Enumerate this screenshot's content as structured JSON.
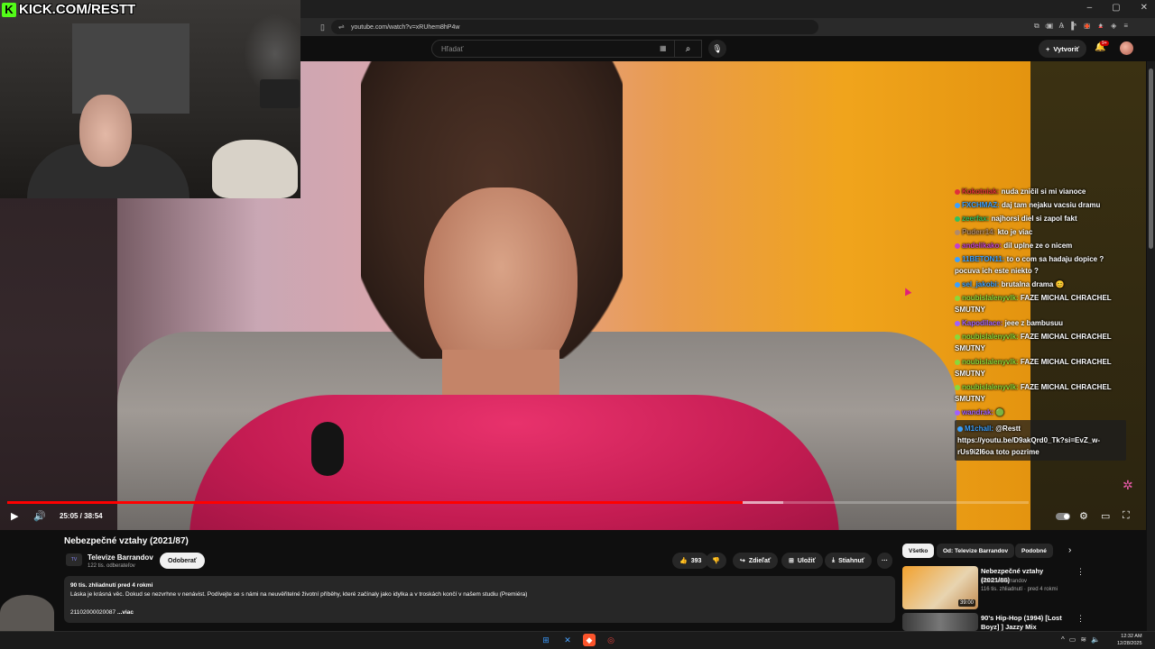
{
  "stream": {
    "kick_url": "KICK.COM/RESTT"
  },
  "browser": {
    "url": "youtube.com/watch?v=xRUhem8hP4w",
    "window_controls": [
      "–",
      "▢",
      "✕"
    ]
  },
  "yt_header": {
    "search_placeholder": "Hľadať",
    "create_label": "Vytvoriť",
    "notif_badge": "9+"
  },
  "player": {
    "current_time": "25:05",
    "duration": "38:54",
    "time_display": "25:05 / 38:54",
    "progress_fraction": 0.72,
    "buffered_start_fraction": 0.72,
    "buffered_end_fraction": 0.76
  },
  "chat": [
    {
      "user": "Kokotniak",
      "color": "#e0303a",
      "text": "nuda zničil si mi vianoce"
    },
    {
      "user": "FXCHMAZ",
      "color": "#3aa0ff",
      "text": "daj tam nejaku vacsiu dramu"
    },
    {
      "user": "zeerfax",
      "color": "#30c060",
      "text": "najhorsi diel si zapol fakt"
    },
    {
      "user": "Puderr14",
      "color": "#b08a6a",
      "text": "kto je viac"
    },
    {
      "user": "andelikako",
      "color": "#c040d0",
      "text": "dil uplne ze o nicem"
    },
    {
      "user": "11BETON11",
      "color": "#3aa0ff",
      "text": "to o com sa hadaju dopice ? pocuva ich este niekto ?"
    },
    {
      "user": "sel_jakobi",
      "color": "#3aa0ff",
      "text": "brutalna drama 😊"
    },
    {
      "user": "noubislalenyvlk",
      "color": "#8ad83a",
      "text": "FAZE MICHAL CHRACHEL SMUTNY"
    },
    {
      "user": "Kapodilace",
      "color": "#a060ff",
      "text": "jeee z bambusuu"
    },
    {
      "user": "noubislalenyvlk",
      "color": "#8ad83a",
      "text": "FAZE MICHAL CHRACHEL SMUTNY"
    },
    {
      "user": "noubislalenyvlk",
      "color": "#8ad83a",
      "text": "FAZE MICHAL CHRACHEL SMUTNY"
    },
    {
      "user": "noubislalenyvlk",
      "color": "#8ad83a",
      "text": "FAZE MICHAL CHRACHEL SMUTNY"
    },
    {
      "user": "wandrak",
      "color": "#a060ff",
      "text": "🟢"
    },
    {
      "user": "M1chall",
      "color": "#3aa0ff",
      "text": "@Restt https://youtu.be/D9akQrd0_Tk?si=EvZ_w-rUs9i2l6oa toto pozrime"
    }
  ],
  "video_info": {
    "title": "Nebezpečné vztahy (2021/87)",
    "channel": "Televize Barrandov",
    "channel_avatar_text": "TV",
    "subscribers": "122 tis. odberateľov",
    "subscribe_label": "Odoberať",
    "likes": "393",
    "share_label": "Zdieľať",
    "save_label": "Uložiť",
    "download_label": "Stiahnuť",
    "more_label": "···",
    "meta": "90 tis. zhliadnutí  pred 4 rokmi",
    "description": "Láska je krásná věc. Dokud se nezvrhne v nenávist. Podívejte se s námi na neuvěřitelné životní příběhy, které začínaly jako idylka a v troskách končí v našem studiu (Premiéra)",
    "code": "21102000020087",
    "more": "...viac"
  },
  "sidebar": {
    "chips": [
      "Všetko",
      "Od: Televize Barrandov",
      "Podobné"
    ],
    "recs": [
      {
        "title": "Nebezpečné vztahy (2021/86)",
        "channel": "Televize Barrandov",
        "meta": "116 tis. zhliadnutí · pred 4 rokmi",
        "duration": "39:00"
      },
      {
        "title": "90's Hip-Hop (1994) [Lost Boyz] ] Jazzy Mix",
        "channel": "",
        "meta": "",
        "duration": ""
      }
    ]
  },
  "taskbar": {
    "time": "12:32 AM",
    "date": "12/28/2025"
  }
}
